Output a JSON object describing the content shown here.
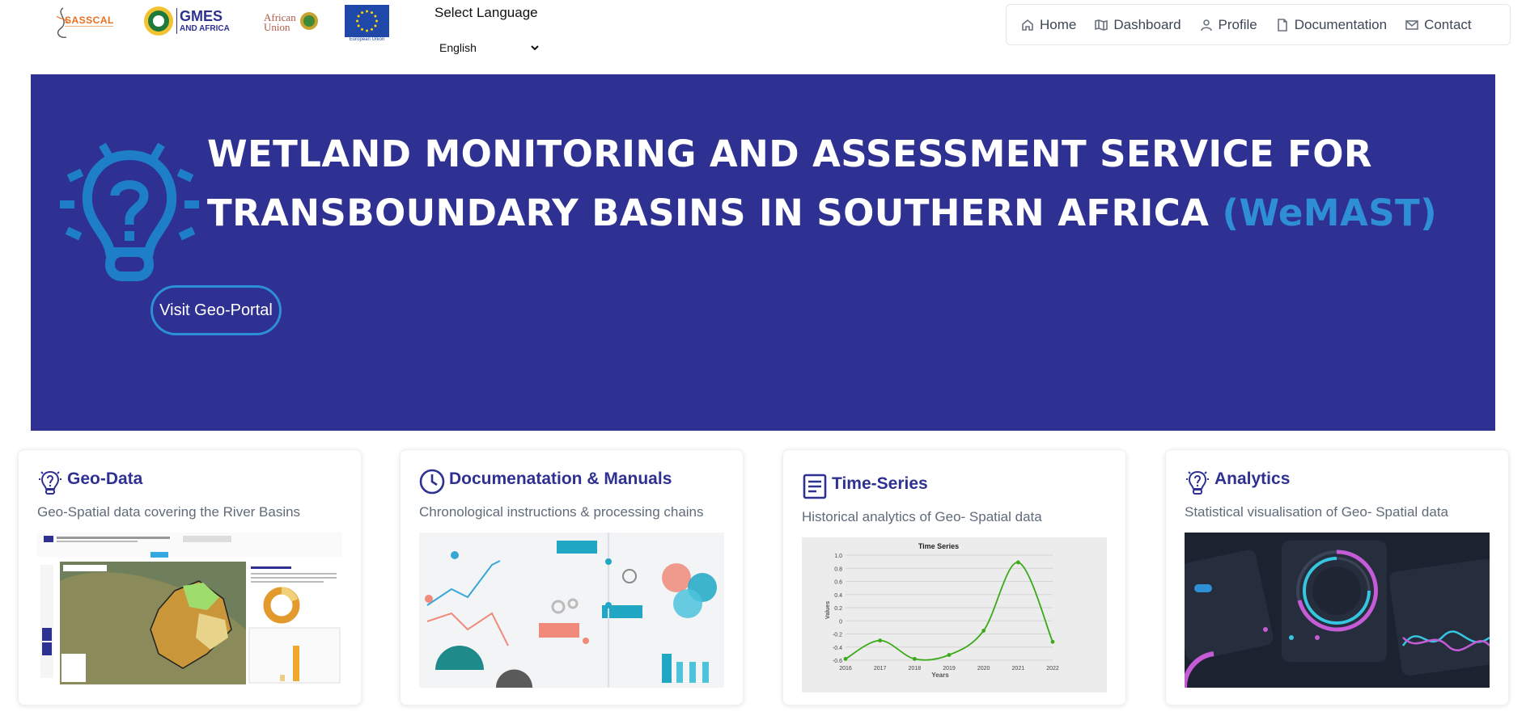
{
  "header": {
    "logos": [
      {
        "name": "SASSCAL",
        "text": "SASSCAL"
      },
      {
        "name": "GMES and Africa",
        "text": "GMES",
        "sub": "AND AFRICA"
      },
      {
        "name": "African Union",
        "text": "African Union"
      },
      {
        "name": "European Union",
        "text": "European Union"
      }
    ],
    "language": {
      "label": "Select Language",
      "selected": "English"
    },
    "nav": [
      {
        "label": "Home",
        "icon": "home-icon"
      },
      {
        "label": "Dashboard",
        "icon": "map-icon"
      },
      {
        "label": "Profile",
        "icon": "user-icon"
      },
      {
        "label": "Documentation",
        "icon": "file-icon"
      },
      {
        "label": "Contact",
        "icon": "mail-icon"
      }
    ]
  },
  "hero": {
    "title_line1": "WETLAND MONITORING AND ASSESSMENT SERVICE FOR",
    "title_line2": "TRANSBOUNDARY BASINS IN SOUTHERN AFRICA",
    "acronym": "(WeMAST)",
    "button_label": "Visit Geo-Portal",
    "background_color": "#2e3192",
    "accent_color": "#2f8fd6",
    "icon": "lightbulb-question-icon"
  },
  "cards": [
    {
      "title": "Geo-Data",
      "description": "Geo-Spatial data covering the River Basins",
      "icon": "lightbulb-question-icon"
    },
    {
      "title": "Documenatation & Manuals",
      "description": "Chronological instructions & processing chains",
      "icon": "clock-icon"
    },
    {
      "title": "Time-Series",
      "description": "Historical analytics of Geo- Spatial data",
      "icon": "document-lines-icon"
    },
    {
      "title": "Analytics",
      "description": "Statistical visualisation of Geo- Spatial data",
      "icon": "lightbulb-question-icon"
    }
  ],
  "chart_data": {
    "type": "line",
    "title": "Time Series",
    "xlabel": "Years",
    "ylabel": "Values",
    "x": [
      2016,
      2017,
      2018,
      2019,
      2020,
      2021,
      2022
    ],
    "y": [
      -0.58,
      -0.3,
      -0.58,
      -0.52,
      -0.15,
      0.89,
      -0.32
    ],
    "ylim": [
      -0.6,
      1.0
    ],
    "yticks": [
      "1.0",
      "0.8",
      "0.6",
      "0.4",
      "0.2",
      "0",
      "-0.2",
      "-0.4",
      "-0.6"
    ],
    "color": "#3aaa1a"
  }
}
